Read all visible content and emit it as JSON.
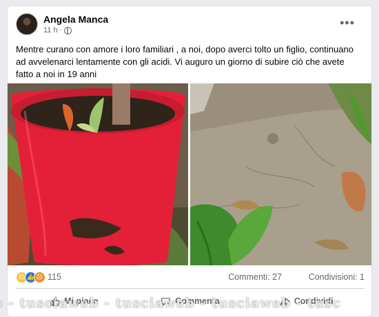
{
  "post": {
    "author": "Angela Manca",
    "time": "11 h ·",
    "text": "Mentre curano con amore i loro familiari , a noi, dopo averci tolto un figlio, continuano ad avvelenarci lentamente con gli acidi. Vi auguro un giorno di  subire ciò che avete fatto a noi in 19 anni"
  },
  "menu_icon": "more-horizontal-icon",
  "stats": {
    "reaction_count": "115",
    "comments": "Commenti: 27",
    "shares": "Condivisioni: 1"
  },
  "actions": {
    "like": "Mi piace",
    "comment": "Commenta",
    "share": "Condividi"
  },
  "watermark": "b - tusciaweb - tusciaweb - tusciaweb - tusc",
  "colors": {
    "brand_blue": "#1877f2",
    "text_secondary": "#65676b",
    "pot_red": "#e8203a"
  }
}
